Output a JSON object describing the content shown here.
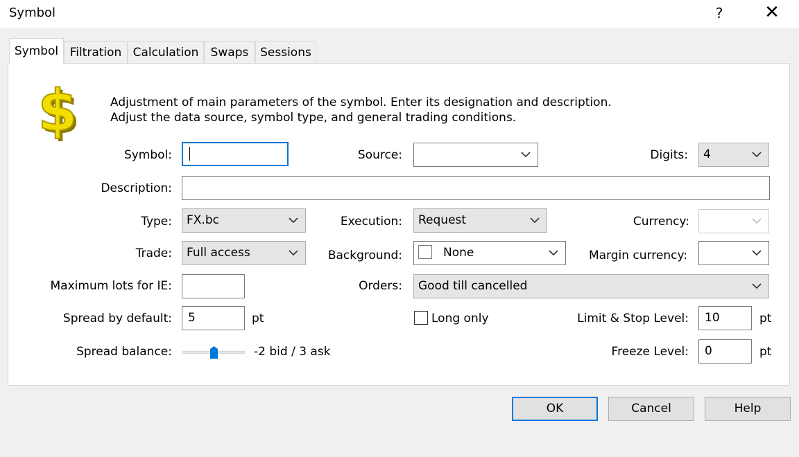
{
  "window": {
    "title": "Symbol",
    "help_glyph": "?",
    "close_glyph": "✕"
  },
  "tabs": [
    {
      "label": "Symbol",
      "active": true
    },
    {
      "label": "Filtration"
    },
    {
      "label": "Calculation"
    },
    {
      "label": "Swaps"
    },
    {
      "label": "Sessions"
    }
  ],
  "description": {
    "line1": "Adjustment of main parameters of the symbol. Enter its designation and description.",
    "line2": "Adjust the data source, symbol type, and general trading conditions."
  },
  "icon": {
    "name": "dollar-sign-icon",
    "color": "#f2dd00"
  },
  "fields": {
    "symbol": {
      "label": "Symbol:",
      "value": ""
    },
    "source": {
      "label": "Source:",
      "value": ""
    },
    "digits": {
      "label": "Digits:",
      "value": "4"
    },
    "description": {
      "label": "Description:",
      "value": ""
    },
    "type": {
      "label": "Type:",
      "value": "FX.bc"
    },
    "execution": {
      "label": "Execution:",
      "value": "Request"
    },
    "currency": {
      "label": "Currency:",
      "value": ""
    },
    "trade": {
      "label": "Trade:",
      "value": "Full access"
    },
    "background": {
      "label": "Background:",
      "value": "None"
    },
    "margin_currency": {
      "label": "Margin currency:",
      "value": ""
    },
    "max_lots_ie": {
      "label": "Maximum lots for IE:",
      "value": ""
    },
    "orders": {
      "label": "Orders:",
      "value": "Good till cancelled"
    },
    "spread_default": {
      "label": "Spread by default:",
      "value": "5",
      "unit": "pt"
    },
    "long_only": {
      "label": "Long only",
      "checked": false
    },
    "limit_stop": {
      "label": "Limit & Stop Level:",
      "value": "10",
      "unit": "pt"
    },
    "spread_balance": {
      "label": "Spread balance:",
      "value_text": "-2 bid / 3 ask",
      "position": 0.5
    },
    "freeze_level": {
      "label": "Freeze Level:",
      "value": "0",
      "unit": "pt"
    }
  },
  "buttons": {
    "ok": "OK",
    "cancel": "Cancel",
    "help": "Help"
  },
  "colors": {
    "focus": "#0078d7",
    "thumb": "#0078d7"
  }
}
